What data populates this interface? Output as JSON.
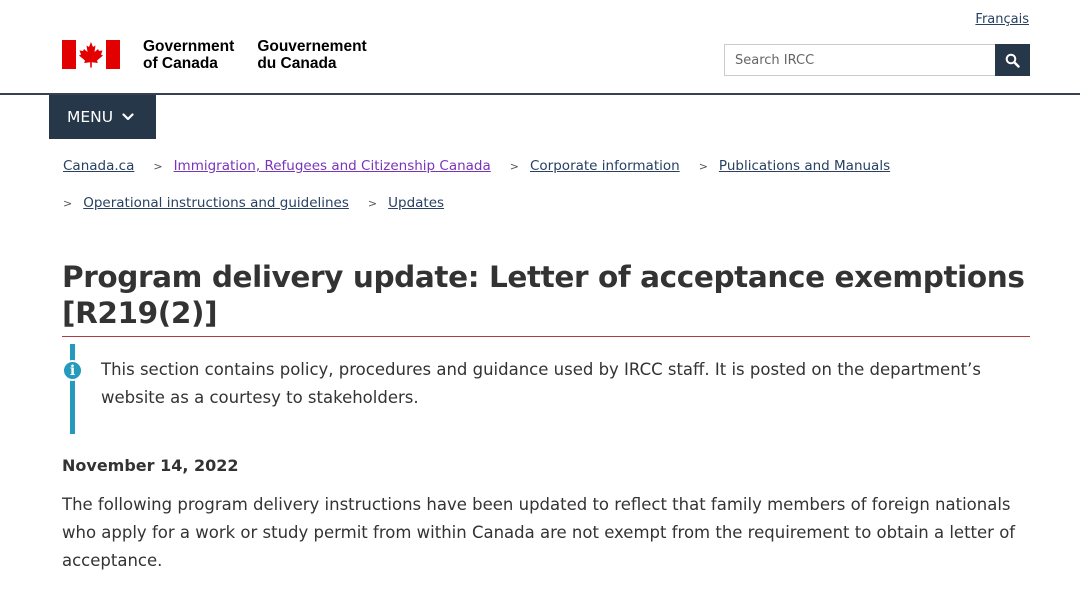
{
  "header": {
    "language_link": "Français",
    "brand": {
      "en_line1": "Government",
      "en_line2": "of Canada",
      "fr_line1": "Gouvernement",
      "fr_line2": "du Canada"
    },
    "search": {
      "placeholder": "Search IRCC",
      "button_icon": "search-icon"
    }
  },
  "menu": {
    "label": "MENU",
    "icon": "chevron-down-icon"
  },
  "breadcrumbs": {
    "row1": [
      {
        "label": "Canada.ca",
        "visited": false
      },
      {
        "label": "Immigration, Refugees and Citizenship Canada",
        "visited": true
      },
      {
        "label": "Corporate information",
        "visited": false
      },
      {
        "label": "Publications and Manuals",
        "visited": false
      }
    ],
    "row2": [
      {
        "label": "Operational instructions and guidelines",
        "visited": false
      },
      {
        "label": "Updates",
        "visited": false
      }
    ],
    "separator": ">"
  },
  "main": {
    "title_line1": "Program delivery update: Letter of acceptance exemptions",
    "title_line2": "[R219(2)]",
    "alert": {
      "icon": "info-icon",
      "text": "This section contains policy, procedures and guidance used by IRCC staff. It is posted on the department’s website as a courtesy to stakeholders."
    },
    "date": "November 14, 2022",
    "paragraph": "The following program delivery instructions have been updated to reflect that family members of foreign nationals who apply for a work or study permit from within Canada are not exempt from the requirement to obtain a letter of acceptance."
  },
  "colors": {
    "navy": "#26374a",
    "link": "#284162",
    "visited_link": "#7834bc",
    "title_rule": "#af3c43",
    "info": "#269abc",
    "flag_red": "#e20000"
  }
}
